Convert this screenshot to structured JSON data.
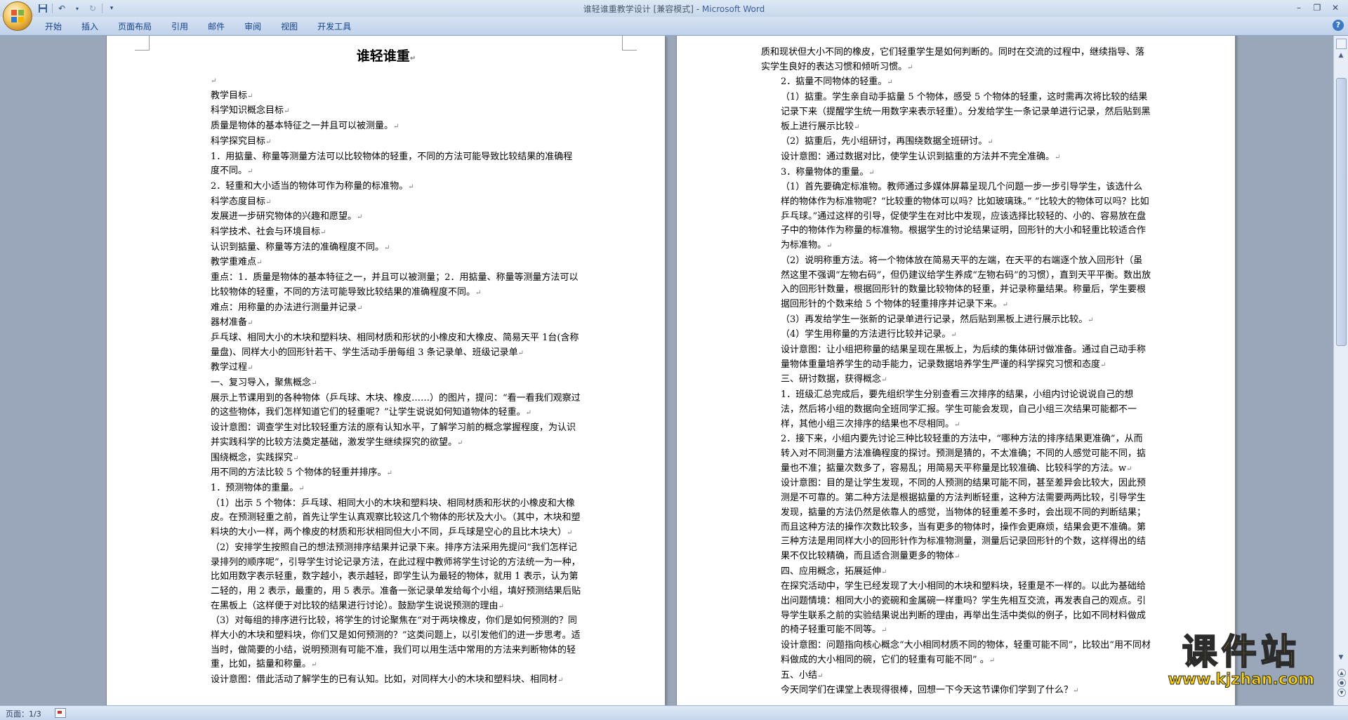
{
  "window": {
    "title_doc": "谁轻谁重教学设计 [兼容模式] - ",
    "title_app": "Microsoft Word"
  },
  "qat": {
    "save_icon": "save-icon",
    "undo_icon": "undo-icon",
    "redo_icon": "redo-icon",
    "customize_icon": "dropdown-icon"
  },
  "ribbon": {
    "tabs": [
      "开始",
      "插入",
      "页面布局",
      "引用",
      "邮件",
      "审阅",
      "视图",
      "开发工具"
    ]
  },
  "page1": {
    "title": "谁轻谁重",
    "paragraphs": [
      {
        "t": "",
        "i": true
      },
      {
        "t": "教学目标",
        "i": true
      },
      {
        "t": "科学知识概念目标",
        "i": true
      },
      {
        "t": "质量是物体的基本特征之一并且可以被测量。",
        "i": true
      },
      {
        "t": "科学探究目标",
        "i": true
      },
      {
        "t": "1．用掂量、称量等测量方法可以比较物体的轻重，不同的方法可能导致比较结果的准确程度不同。",
        "i": true
      },
      {
        "t": "2．轻重和大小适当的物体可作为称量的标准物。",
        "i": true
      },
      {
        "t": "科学态度目标",
        "i": true
      },
      {
        "t": "发展进一步研究物体的兴趣和愿望。",
        "i": true
      },
      {
        "t": "科学技术、社会与环境目标",
        "i": true
      },
      {
        "t": "认识到掂量、称量等方法的准确程度不同。",
        "i": true
      },
      {
        "t": "教学重难点",
        "i": true
      },
      {
        "t": "重点：1．质量是物体的基本特征之一，并且可以被测量；2．用掂量、称量等测量方法可以比较物体的轻重，不同的方法可能导致比较结果的准确程度不同。",
        "i": true
      },
      {
        "t": "难点：用称量的办法进行测量并记录",
        "i": true
      },
      {
        "t": "器材准备",
        "i": true
      },
      {
        "t": "乒乓球、相同大小的木块和塑料块、相同材质和形状的小橡皮和大橡皮、简易天平 1台(含称量盘)、同样大小的回形针若干、学生活动手册每组 3 条记录单、班级记录单",
        "i": true
      },
      {
        "t": "教学过程",
        "i": true
      },
      {
        "t": "一、复习导入，聚焦概念",
        "i": true
      },
      {
        "t": "展示上节课用到的各种物体（乒乓球、木块、橡皮……）的图片，提问：“看一看我们观察过的这些物体，我们怎样知道它们的轻重呢？”让学生说说如何知道物体的轻重。",
        "i": true
      },
      {
        "t": "设计意图：调查学生对比较轻重方法的原有认知水平，了解学习前的概念掌握程度，为认识并实践科学的比较方法奠定基础，激发学生继续探究的欲望。",
        "i": true
      },
      {
        "t": "围绕概念，实践探究",
        "i": true
      },
      {
        "t": "用不同的方法比较 5 个物体的轻重并排序。",
        "i": true
      },
      {
        "t": "1．预测物体的重量。",
        "i": true
      },
      {
        "t": "（1）出示 5 个物体：乒乓球、相同大小的木块和塑料块、相同材质和形状的小橡皮和大橡皮。在预测轻重之前，首先让学生认真观察比较这几个物体的形状及大小。（其中，木块和塑料块的大小一样，两个橡皮的材质和形状相同但大小不同，乒乓球是空心的且比木块大）",
        "i": true
      },
      {
        "t": "（2）安排学生按照自己的想法预测排序结果并记录下来。排序方法采用先提问“我们怎样记录排列的顺序呢”，引导学生讨论记录方法，在此过程中教师将学生讨论的方法统一为一种，比如用数字表示轻重，数字越小，表示越轻，即学生认为最轻的物体，就用 1 表示，认为第二轻的，用 2 表示，最重的，用 5 表示。准备一张记录单发给每个小组，填好预测结果后贴在黑板上（这样便于对比较的结果进行讨论）。鼓励学生说说预测的理由",
        "i": true
      },
      {
        "t": "（3）对每组的排序进行比较，将学生的讨论聚焦在“对于两块橡皮，你们是如何预测的？同样大小的木块和塑料块，你们又是如何预测的？”这类问题上，以引发他们的进一步思考。适当时，做简要的小结，说明预测有可能不准，我们可以用生活中常用的方法来判断物体的轻重，比如，掂量和称量。",
        "i": true
      },
      {
        "t": "设计意图：借此活动了解学生的已有认知。比如，对同样大小的木块和塑料块、相同材",
        "i": true
      }
    ]
  },
  "page2": {
    "paragraphs": [
      {
        "t": "质和现状但大小不同的橡皮，它们轻重学生是如何判断的。同时在交流的过程中，继续指导、落实学生良好的表达习惯和倾听习惯。",
        "i": false
      },
      {
        "t": "2．掂量不同物体的轻重。",
        "i": true
      },
      {
        "t": "（1）掂重。学生亲自动手掂量 5 个物体，感受 5 个物体的轻重，这时需再次将比较的结果记录下来（提醒学生统一用数字来表示轻重）。分发给学生一条记录单进行记录，然后贴到黑板上进行展示比较",
        "i": true
      },
      {
        "t": "（2）掂重后，先小组研讨，再围绕数据全班研讨。",
        "i": true
      },
      {
        "t": "设计意图：通过数据对比，使学生认识到掂重的方法并不完全准确。",
        "i": true
      },
      {
        "t": "3．称量物体的重量。",
        "i": true
      },
      {
        "t": "（1）首先要确定标准物。教师通过多媒体屏幕呈现几个问题一步一步引导学生，该选什么样的物体作为标准物呢？“比较重的物体可以吗？比如玻璃珠。” “比较大的物体可以吗？比如乒乓球。”通过这样的引导，促使学生在对比中发现，应该选择比较轻的、小的、容易放在盘子中的物体作为称量的标准物。根据学生的讨论结果证明，回形针的大小和轻重比较适合作为标准物。",
        "i": true
      },
      {
        "t": "（2）说明称重方法。将一个物体放在简易天平的左端，在天平的右端逐个放入回形针（虽然这里不强调“左物右码”，但仍建议给学生养成“左物右码”的习惯），直到天平平衡。数出放入的回形针数量，根据回形针的数量比较物体的轻重，并记录称量结果。称量后，学生要根据回形针的个数来给 5 个物体的轻重排序并记录下来。",
        "i": true
      },
      {
        "t": "（3）再发给学生一张新的记录单进行记录，然后贴到黑板上进行展示比较。",
        "i": true
      },
      {
        "t": "（4）学生用称量的方法进行比较并记录。",
        "i": true
      },
      {
        "t": "设计意图：让小组把称量的结果呈现在黑板上，为后续的集体研讨做准备。通过自己动手称量物体重量培养学生的动手能力，记录数据培养学生严谨的科学探究习惯和态度",
        "i": true
      },
      {
        "t": "三、研讨数据，获得概念",
        "i": true
      },
      {
        "t": "1．班级汇总完成后，要先组织学生分别查看三次排序的结果，小组内讨论说说自己的想法，然后将小组的数据向全班同学汇报。学生可能会发现，自己小组三次结果可能都不一样，其他小组三次排序的结果也不尽相同。",
        "i": true
      },
      {
        "t": "2．接下来，小组内要先讨论三种比较轻重的方法中，“哪种方法的排序结果更准确”，从而转入对不同测量方法准确程度的探讨。预测是猜的，不太准确；不同的人感觉可能不同，掂量也不准；掂量次数多了，容易乱；用简易天平称量是比较准确、比较科学的方法。w",
        "i": true
      },
      {
        "t": "设计意图：目的是让学生发现，不同的人预测的结果可能不同，甚至差异会比较大，因此预测是不可靠的。第二种方法是根据掂量的方法判断轻重，这种方法需要两两比较，引导学生发现，掂量的方法仍然是依靠人的感觉，当物体的轻重差不多时，会出现不同的判断结果；而且这种方法的操作次数比较多，当有更多的物体时，操作会更麻烦，结果会更不准确。第三种方法是用同样大小的回形针作为标准物测量，测量后记录回形针的个数，这样得出的结果不仅比较精确，而且适合测量更多的物体",
        "i": true
      },
      {
        "t": "四、应用概念，拓展延伸",
        "i": true
      },
      {
        "t": "在探究活动中，学生已经发现了大小相同的木块和塑料块，轻重是不一样的。以此为基础给出问题情境：相同大小的瓷碗和金属碗一样重吗？学生先相互交流，再发表自己的观点。引导学生联系之前的实验结果说出判断的理由，再举出生活中类似的例子，比如不同材料做成的椅子轻重可能不同等。",
        "i": true
      },
      {
        "t": "设计意图：问题指向核心概念“大小相同材质不同的物体，轻重可能不同”，比较出“用不同材料做成的大小相同的碗，它们的轻重有可能不同” 。",
        "i": true
      },
      {
        "t": "五、小结",
        "i": true
      },
      {
        "t": "今天同学们在课堂上表现得很棒，回想一下今天这节课你们学到了什么？",
        "i": true
      }
    ]
  },
  "statusbar": {
    "page_info": "页面：1/3"
  },
  "watermark": {
    "cn": "课件站",
    "url": "www.kjzhan.com"
  }
}
